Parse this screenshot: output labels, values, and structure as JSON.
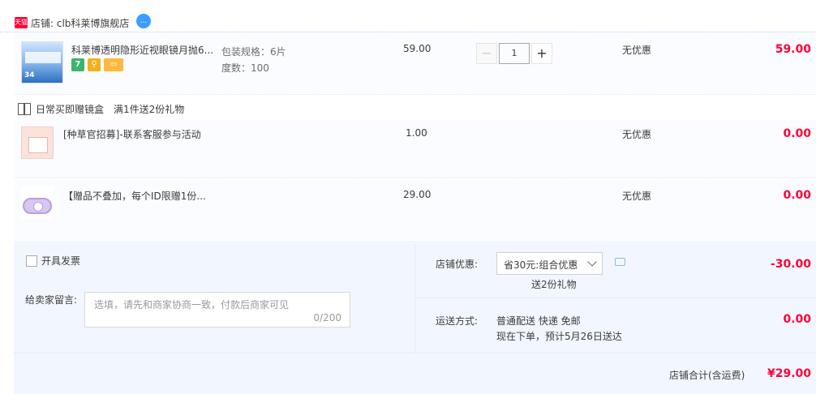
{
  "shop": {
    "badge": "天猫",
    "name": "店铺: clb科莱博旗舰店",
    "chat_badge": "..."
  },
  "items": [
    {
      "title": "科莱博透明隐形近视眼镜月抛6...",
      "spec_pack": "包装规格：6片",
      "spec_degree": "度数：100",
      "price": "59.00",
      "quantity": "1",
      "discount": "无优惠",
      "subtotal": "59.00",
      "thumb_text": "34"
    },
    {
      "title": "[种草官招募]-联系客服参与活动",
      "price": "1.00",
      "discount": "无优惠",
      "subtotal": "0.00"
    },
    {
      "title": "【赠品不叠加，每个ID限赠1份...",
      "price": "29.00",
      "discount": "无优惠",
      "subtotal": "0.00"
    }
  ],
  "promo": {
    "name": "日常买即赠镜盒",
    "rule": "满1件送2份礼物"
  },
  "service_icons": [
    "7",
    "⚲",
    "▭"
  ],
  "invoice": {
    "label": "开具发票"
  },
  "message": {
    "label": "给卖家留言:",
    "placeholder": "选填，请先和商家协商一致，付款后商家可见",
    "counter": "0/200"
  },
  "coupon": {
    "label": "店铺优惠:",
    "selected": "省30元:组合优惠",
    "sub": "送2份礼物",
    "amount": "-30.00"
  },
  "shipping": {
    "label": "运送方式:",
    "method": "普通配送 快递 免邮",
    "eta": "现在下单，预计5月26日送达",
    "amount": "0.00"
  },
  "total": {
    "label": "店铺合计(含运费)",
    "amount": "¥29.00"
  },
  "colors": {
    "accent_red": "#ff0036",
    "panel_bg": "#f2f7ff",
    "row_bg": "#fbfcff"
  }
}
